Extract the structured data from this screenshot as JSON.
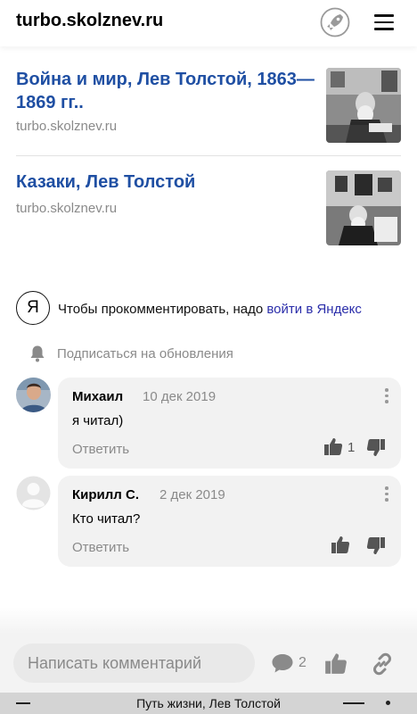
{
  "header": {
    "site_title": "turbo.skolznev.ru",
    "rocket_icon": "rocket-icon",
    "menu_icon": "hamburger-menu-icon"
  },
  "articles": [
    {
      "title": "Война и мир, Лев Толстой, 1863—1869 гг..",
      "source": "turbo.skolznev.ru"
    },
    {
      "title": "Казаки, Лев Толстой",
      "source": "turbo.skolznev.ru"
    }
  ],
  "auth": {
    "ya_letter": "Я",
    "prompt": "Чтобы прокомментировать, надо ",
    "login_link": "войти в Яндекс"
  },
  "subscribe": {
    "label": "Подписаться на обновления"
  },
  "comments": [
    {
      "author": "Михаил",
      "date": "10 дек 2019",
      "text": "я читал)",
      "reply": "Ответить",
      "likes": "1"
    },
    {
      "author": "Кирилл С.",
      "date": "2 дек 2019",
      "text": "Кто читал?",
      "reply": "Ответить",
      "likes": ""
    }
  ],
  "bottom_bar": {
    "placeholder": "Написать комментарий",
    "comment_count": "2"
  },
  "statusbar": {
    "title": "Путь жизни, Лев Толстой"
  },
  "colors": {
    "link_blue": "#1f4fa3",
    "login_link": "#2b2eaa",
    "muted": "#8a8a8a",
    "bubble": "#f2f2f2"
  }
}
